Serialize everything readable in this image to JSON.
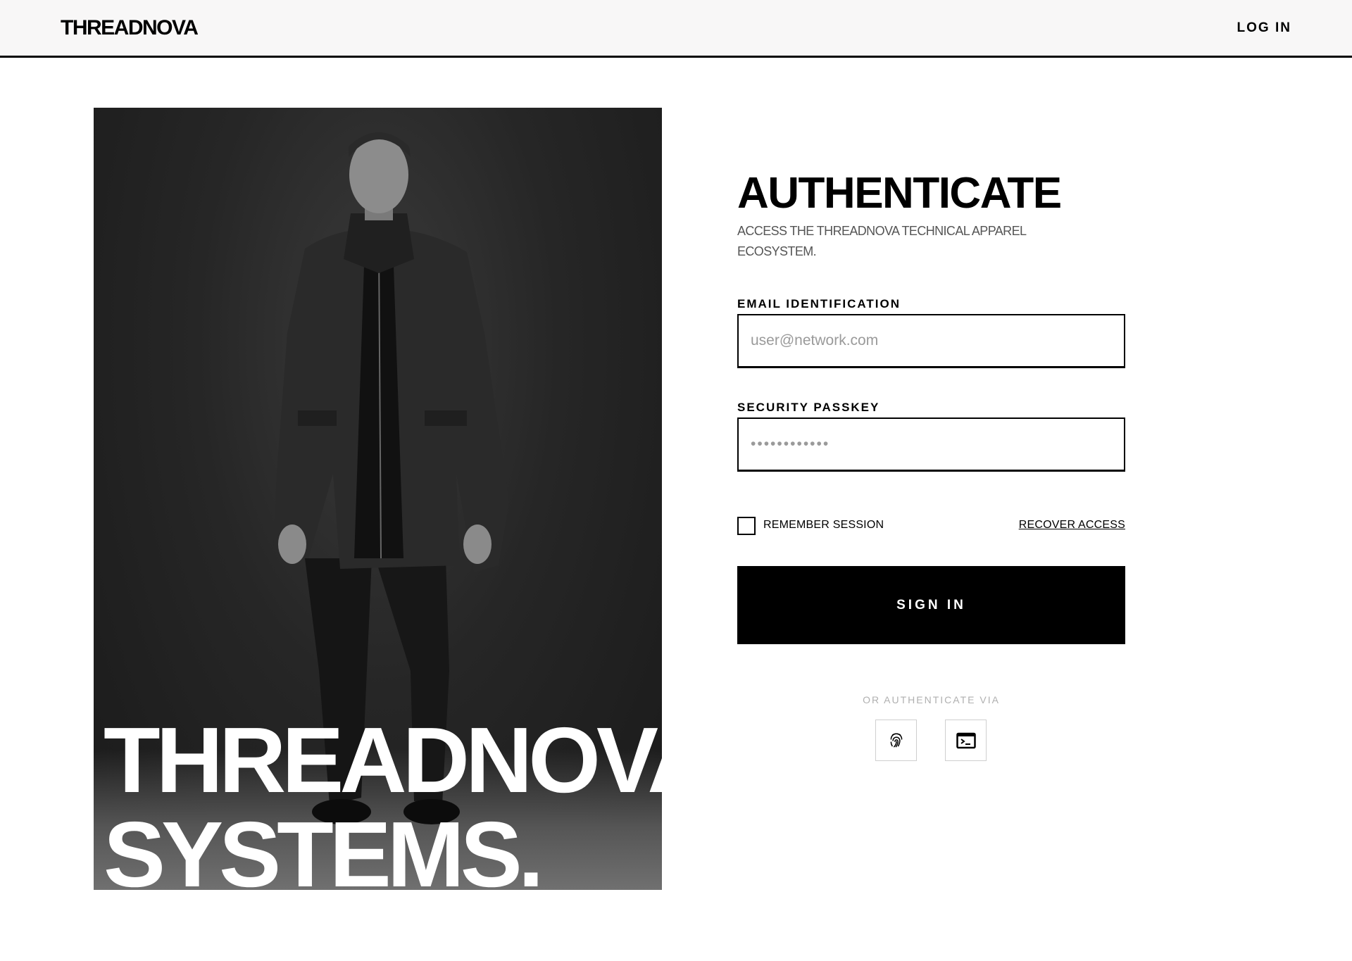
{
  "header": {
    "logo": "THREADNOVA",
    "login_label": "LOG IN"
  },
  "hero": {
    "line1": "THREADNOVA",
    "line2": "SYSTEMS."
  },
  "form": {
    "title": "AUTHENTICATE",
    "subtitle": "ACCESS THE THREADNOVA TECHNICAL APPAREL ECOSYSTEM.",
    "email_label": "EMAIL IDENTIFICATION",
    "email_placeholder": "user@network.com",
    "passkey_label": "SECURITY PASSKEY",
    "passkey_value": "••••••••••••",
    "remember_label": "REMEMBER SESSION",
    "remember_checked": false,
    "recover_label": "RECOVER ACCESS",
    "signin_label": "SIGN IN",
    "alt_label": "OR AUTHENTICATE VIA",
    "alt_methods": [
      {
        "icon": "fingerprint-icon"
      },
      {
        "icon": "terminal-icon"
      }
    ]
  }
}
